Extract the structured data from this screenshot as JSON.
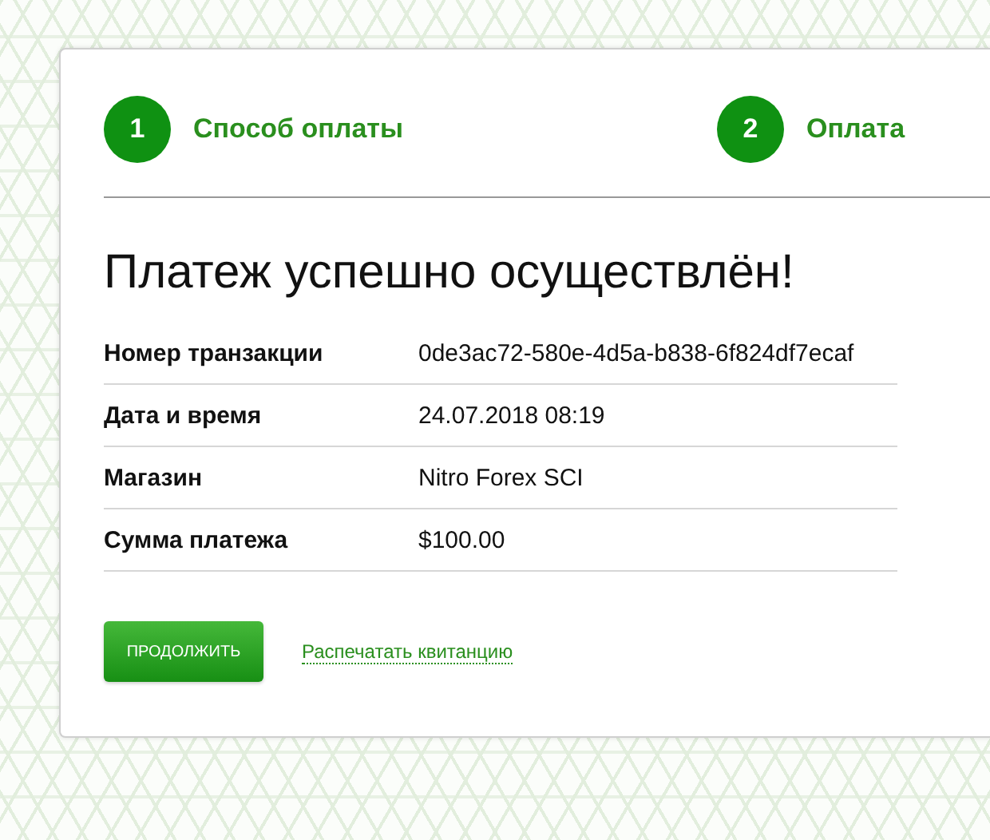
{
  "steps": [
    {
      "number": "1",
      "label": "Способ оплаты"
    },
    {
      "number": "2",
      "label": "Оплата"
    }
  ],
  "title": "Платеж успешно осуществлён!",
  "details": [
    {
      "label": "Номер транзакции",
      "value": "0de3ac72-580e-4d5a-b838-6f824df7ecaf"
    },
    {
      "label": "Дата и время",
      "value": "24.07.2018 08:19"
    },
    {
      "label": "Магазин",
      "value": "Nitro Forex SCI"
    },
    {
      "label": "Сумма платежа",
      "value": "$100.00"
    }
  ],
  "continue_button": "ПРОДОЛЖИТЬ",
  "print_link": "Распечатать квитанцию"
}
